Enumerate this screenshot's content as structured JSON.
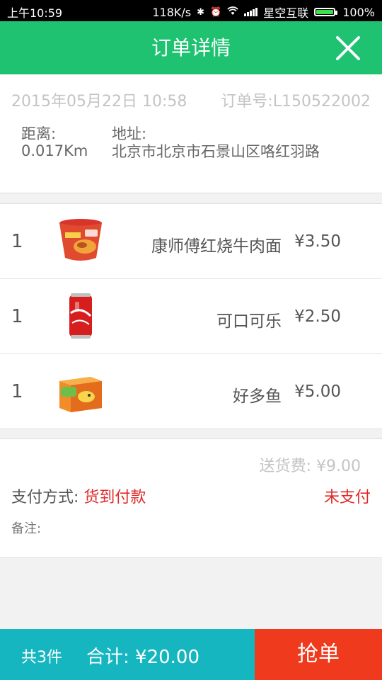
{
  "status_bar": {
    "time": "上午10:59",
    "speed": "118K/s",
    "carrier": "星空互联",
    "battery": "100%",
    "battery_level": 1.0
  },
  "header": {
    "title": "订单详情",
    "close_icon": "close-icon"
  },
  "order": {
    "datetime": "2015年05月22日 10:58",
    "order_no": "订单号:L150522002",
    "distance_label": "距离:",
    "distance_value": "0.017Km",
    "address_label": "地址:",
    "address_value": "北京市北京市石景山区咯红羽路"
  },
  "items": [
    {
      "qty": "1",
      "name": "康师傅红烧牛肉面",
      "price": "¥3.50",
      "icon": "instant-noodle-cup-icon"
    },
    {
      "qty": "1",
      "name": "可口可乐",
      "price": "¥2.50",
      "icon": "cola-can-icon"
    },
    {
      "qty": "1",
      "name": "好多鱼",
      "price": "¥5.00",
      "icon": "snack-box-icon"
    }
  ],
  "payment": {
    "delivery_fee": "送货费: ¥9.00",
    "method_label": "支付方式: ",
    "method_value": "货到付款",
    "status": "未支付",
    "note_label": "备注:"
  },
  "bottom": {
    "count": "共3件",
    "total": "合计: ¥20.00",
    "grab_button": "抢单"
  },
  "colors": {
    "header": "#1ec271",
    "bottom_left": "#16b6c0",
    "grab_button": "#f03a1e",
    "accent_red": "#e02a2a"
  }
}
